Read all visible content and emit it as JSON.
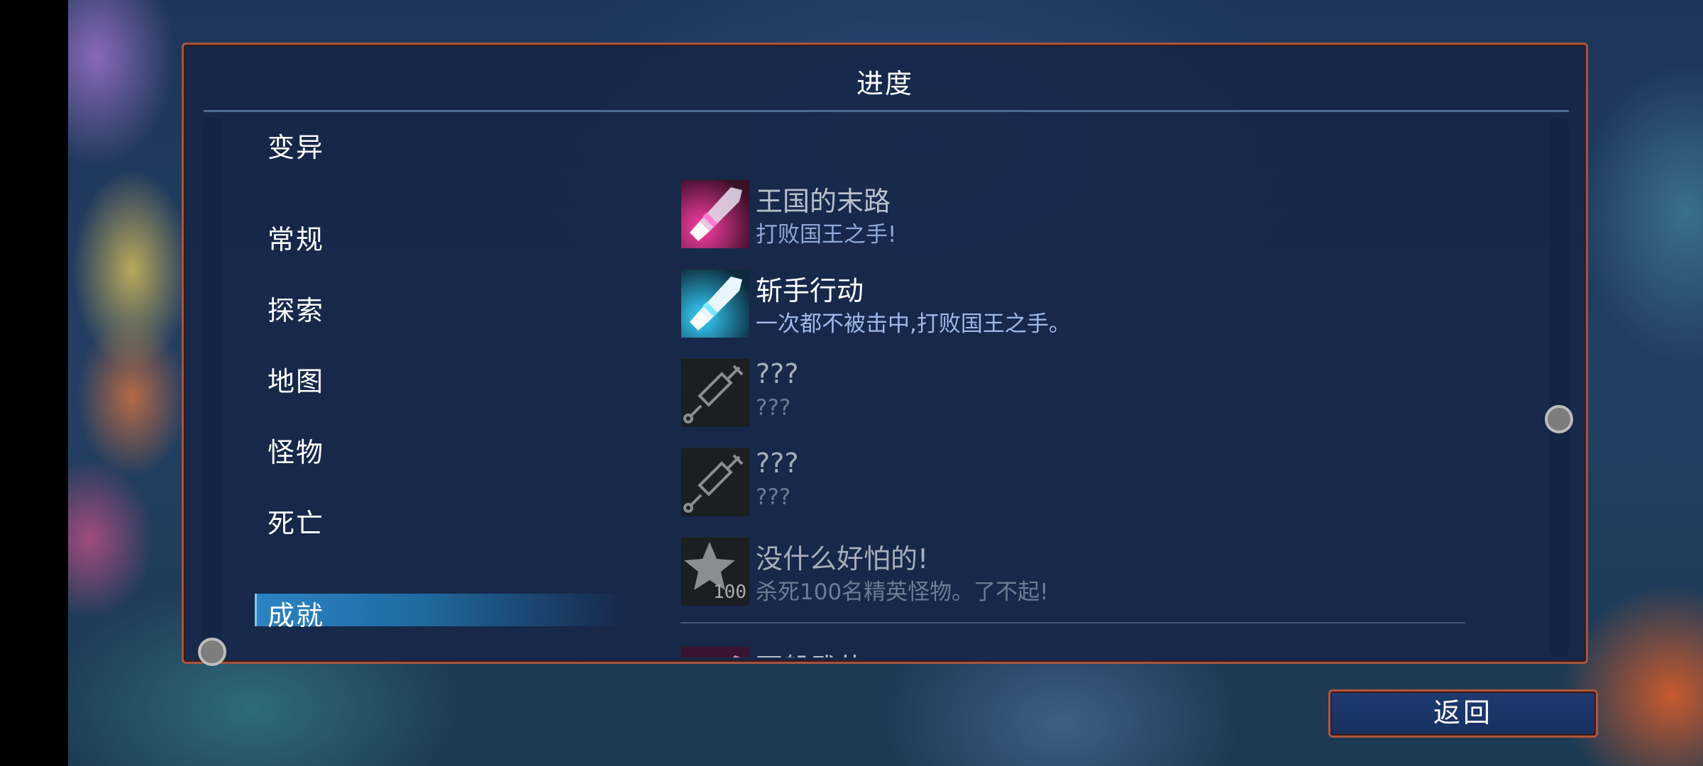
{
  "panel": {
    "title": "进度"
  },
  "categories": [
    {
      "label": "变异",
      "selected": false
    },
    {
      "label": "常规",
      "selected": false
    },
    {
      "label": "探索",
      "selected": false
    },
    {
      "label": "地图",
      "selected": false
    },
    {
      "label": "怪物",
      "selected": false
    },
    {
      "label": "死亡",
      "selected": false
    },
    {
      "label": "成就",
      "selected": true
    }
  ],
  "achievements": [
    {
      "name": "王国的末路",
      "desc": "打败国王之手!",
      "icon": "pink-crystal-sword-icon",
      "state": "dim"
    },
    {
      "name": "斩手行动",
      "desc": "一次都不被击中,打败国王之手。",
      "icon": "cyan-crystal-sword-icon",
      "state": "unlocked"
    },
    {
      "name": "???",
      "desc": "???",
      "icon": "syringe-icon",
      "state": "locked"
    },
    {
      "name": "???",
      "desc": "???",
      "icon": "syringe-icon",
      "state": "locked"
    },
    {
      "name": "没什么好怕的!",
      "desc": "杀死100名精英怪物。了不起!",
      "icon": "star-100-icon",
      "icon_text": "100",
      "state": "locked"
    },
    {
      "name": "百般武艺",
      "desc": "",
      "icon": "pink-sword-icon",
      "state": "dim"
    }
  ],
  "footer": {
    "back_label": "返回"
  },
  "colors": {
    "panel_border": "#a6543f",
    "panel_bg": "#162648",
    "selected_bar": "#2b84c4",
    "desc_text": "#9fb8e8"
  }
}
